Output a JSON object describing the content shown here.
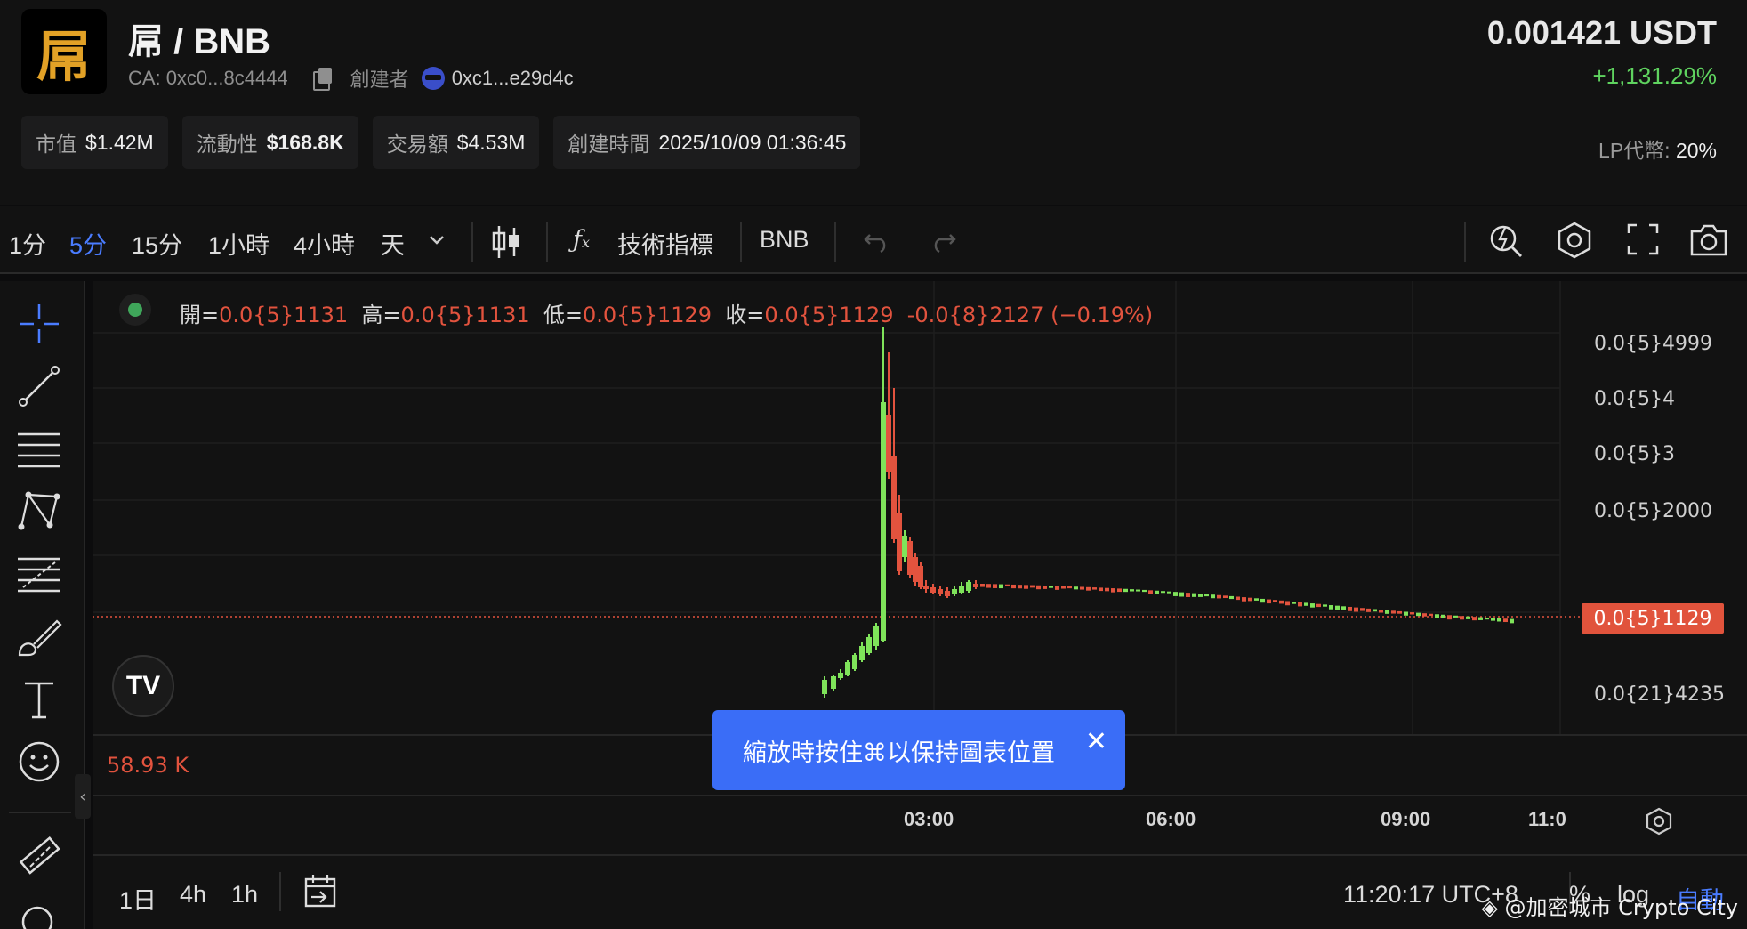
{
  "token": {
    "logo_char": "屌",
    "pair": "屌 / BNB",
    "ca_label": "CA:",
    "ca_value": "0xc0...8c4444",
    "creator_label": "創建者",
    "creator_value": "0xc1...e29d4c",
    "price": "0.001421 USDT",
    "change": "+1,131.29%"
  },
  "stats": [
    {
      "label": "市值",
      "value": "$1.42M"
    },
    {
      "label": "流動性",
      "value": "$168.8K"
    },
    {
      "label": "交易額",
      "value": "$4.53M"
    },
    {
      "label": "創建時間",
      "value": "2025/10/09 01:36:45"
    }
  ],
  "lp": {
    "label": "LP代幣:",
    "value": "20%"
  },
  "toolbar": {
    "intervals": [
      "1分",
      "5分",
      "15分",
      "1小時",
      "4小時",
      "天"
    ],
    "active_interval": "5分",
    "indicators_label": "技術指標",
    "currency_label": "BNB"
  },
  "ohlc": {
    "open_label": "開=",
    "open": "0.0{5}1131",
    "high_label": "高=",
    "high": "0.0{5}1131",
    "low_label": "低=",
    "low": "0.0{5}1129",
    "close_label": "收=",
    "close": "0.0{5}1129",
    "change": "-0.0{8}2127 (−0.19%)"
  },
  "chart_data": {
    "type": "candlestick",
    "y_ticks": [
      "0.0{5}4999",
      "0.0{5}4",
      "0.0{5}3",
      "0.0{5}2000",
      "0.0{5}1129",
      "0.0{21}4235"
    ],
    "last_price": "0.0{5}1129",
    "x_ticks": [
      "03:00",
      "06:00",
      "09:00",
      "11:0"
    ],
    "volume_label": "58.93 K",
    "colors": {
      "up": "#7fe35a",
      "down": "#e2533e",
      "grid": "#1e1e1e"
    }
  },
  "toast": {
    "text": "縮放時按住⌘以保持圖表位置"
  },
  "bottombar": {
    "ranges": [
      "1日",
      "4h",
      "1h"
    ],
    "time": "11:20:17 UTC+8",
    "percent": "%",
    "log": "log",
    "auto": "自動"
  },
  "watermark": "@加密城市 Crypto City"
}
